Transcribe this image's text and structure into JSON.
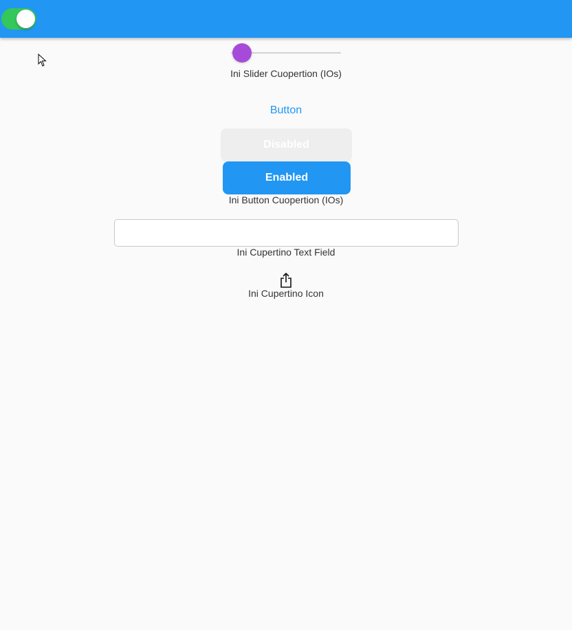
{
  "app_bar": {
    "color": "#2196f3",
    "switch": {
      "on": true,
      "color": "#34c759"
    }
  },
  "slider": {
    "value": 0.1,
    "thumb_color": "#a64bd9",
    "caption": "Ini Slider Cuopertion (IOs)"
  },
  "buttons": {
    "text_button_label": "Button",
    "disabled_label": "Disabled",
    "enabled_label": "Enabled",
    "caption": "Ini Button Cuopertion (IOs)"
  },
  "text_field": {
    "value": "",
    "caption": "Ini Cupertino Text Field"
  },
  "icon_section": {
    "icon": "share-icon",
    "caption": "Ini Cupertino Icon"
  }
}
